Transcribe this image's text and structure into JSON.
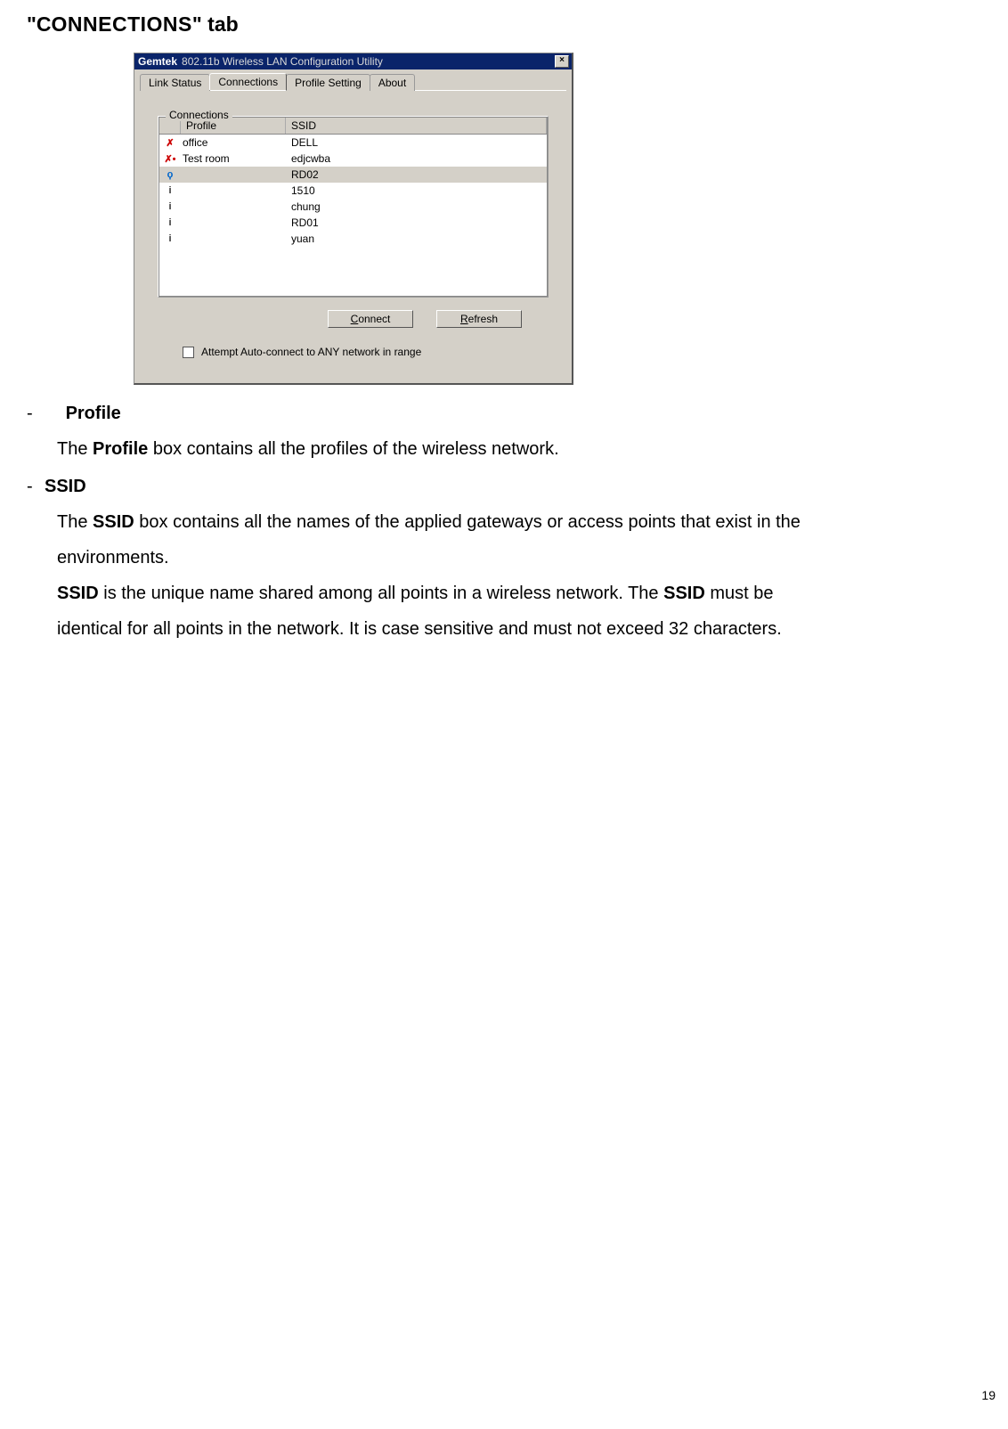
{
  "heading": {
    "quote_open": "\"",
    "cap_c": "C",
    "rest_sc": "ONNECTIONS",
    "quote_close": "\"",
    "suffix": " tab"
  },
  "dialog": {
    "brand": "Gemtek",
    "title": "802.11b Wireless LAN Configuration Utility",
    "close_glyph": "×",
    "tabs": {
      "link_status": "Link Status",
      "connections": "Connections",
      "profile_setting": "Profile Setting",
      "about": "About"
    },
    "group_legend": "Connections",
    "columns": {
      "profile": "Profile",
      "ssid": "SSID"
    },
    "rows": [
      {
        "icon": "red",
        "profile": "office",
        "ssid": "DELL",
        "selected": false
      },
      {
        "icon": "reddot",
        "profile": "Test room",
        "ssid": "edjcwba",
        "selected": false
      },
      {
        "icon": "blue",
        "profile": "",
        "ssid": "RD02",
        "selected": true
      },
      {
        "icon": "pin",
        "profile": "",
        "ssid": "1510",
        "selected": false
      },
      {
        "icon": "pin",
        "profile": "",
        "ssid": "chung",
        "selected": false
      },
      {
        "icon": "pin",
        "profile": "",
        "ssid": "RD01",
        "selected": false
      },
      {
        "icon": "pin",
        "profile": "",
        "ssid": "yuan",
        "selected": false
      }
    ],
    "buttons": {
      "connect_u": "C",
      "connect_rest": "onnect",
      "refresh_u": "R",
      "refresh_rest": "efresh"
    },
    "checkbox_label": "Attempt Auto-connect to ANY network in range"
  },
  "doc": {
    "dash": "-",
    "profile_h": "Profile",
    "profile_p_pre": "The ",
    "profile_p_bold": "Profile",
    "profile_p_post": " box contains all the profiles of the wireless network.",
    "ssid_h": "SSID",
    "ssid_p1_pre": "The ",
    "ssid_p1_bold": "SSID",
    "ssid_p1_post": " box contains all the names of the applied gateways or access points that exist in the",
    "ssid_p1_line2": "environments.",
    "ssid_p2_bold1": "SSID",
    "ssid_p2_mid": " is the unique name shared among all points in a wireless network. The ",
    "ssid_p2_bold2": "SSID",
    "ssid_p2_post": " must be",
    "ssid_p2_line2": "identical for all points in the network. It is case sensitive and must not exceed 32 characters."
  },
  "page_number": "19"
}
